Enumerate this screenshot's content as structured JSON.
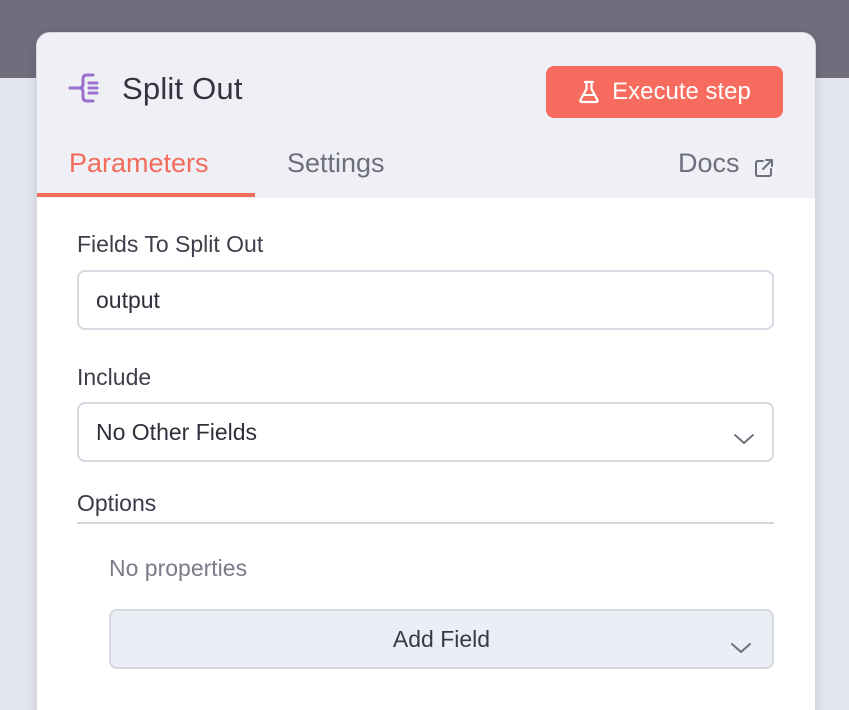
{
  "node": {
    "title": "Split Out",
    "icon": "split-out-icon",
    "execute_label": "Execute step",
    "execute_icon": "flask-icon"
  },
  "tabs": {
    "parameters": "Parameters",
    "settings": "Settings",
    "active": "Parameters",
    "docs": "Docs",
    "docs_icon": "external-link-icon"
  },
  "params": {
    "fields_label": "Fields To Split Out",
    "fields_value": "output",
    "include_label": "Include",
    "include_value": "No Other Fields",
    "options_label": "Options",
    "no_properties": "No properties",
    "add_field_label": "Add Field"
  },
  "colors": {
    "accent": "#f26b5b",
    "execute_button": "#f76c5e",
    "node_icon": "#9b6fd1"
  }
}
